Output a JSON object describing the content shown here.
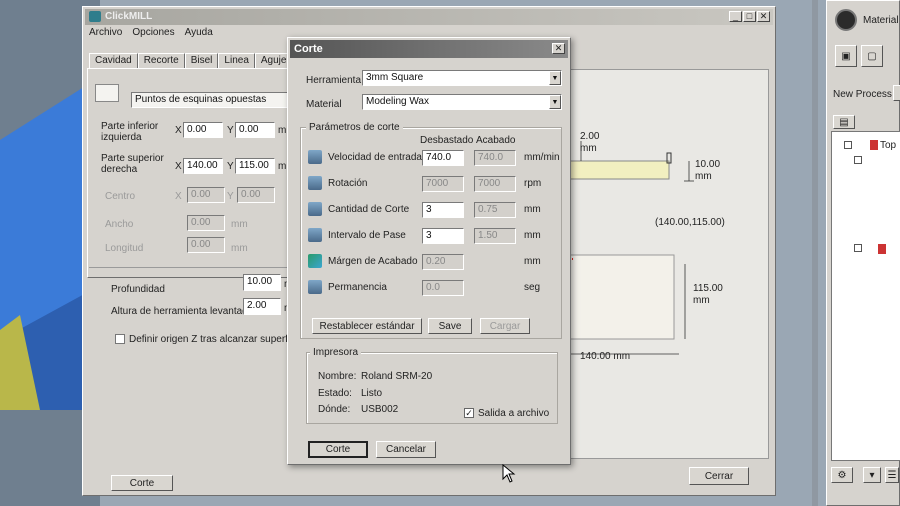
{
  "background": {
    "desktop": "#9aa7b4",
    "cad_blue": "#3b7bd8"
  },
  "main_window": {
    "title": "ClickMILL",
    "menu": [
      "Archivo",
      "Opciones",
      "Ayuda"
    ],
    "tabs": [
      "Cavidad",
      "Recorte",
      "Bisel",
      "Linea",
      "Agujero"
    ],
    "method_value": "Puntos de esquinas opuestas",
    "lower_left_label": "Parte inferior izquierda",
    "upper_right_label": "Parte superior derecha",
    "ll_x": "0.00",
    "ll_y": "0.00",
    "ur_x": "140.00",
    "ur_y": "115.00",
    "unit": "mm",
    "center_label": "Centro",
    "width_label": "Ancho",
    "length_label": "Longitud",
    "center_x": "0.00",
    "center_y": "0.00",
    "width_val": "0.00",
    "length_val": "0.00",
    "depth_label": "Profundidad",
    "depth_val": "10.00",
    "lift_label": "Altura de herramienta levantada",
    "lift_val": "2.00",
    "define_origin_label": "Definir origen Z tras alcanzar superficie",
    "cut_button": "Corte",
    "close_button": "Cerrar"
  },
  "drawing": {
    "dim_top": "2.00",
    "dim_top_unit": "mm",
    "dim_right_top": "10.00",
    "dim_right_top_unit": "mm",
    "corner_coord": "(140.00,115.00)",
    "dim_height": "115.00",
    "dim_height_unit": "mm",
    "dim_width": "140.00 mm"
  },
  "right_panel": {
    "material_label": "Material",
    "process_label": "New Process",
    "tree_top": "Top"
  },
  "dialog": {
    "title": "Corte",
    "tool_label": "Herramienta",
    "tool_value": "3mm Square",
    "material_label": "Material",
    "material_value": "Modeling Wax",
    "params_group": "Parámetros de corte",
    "col_rough": "Desbastado",
    "col_finish": "Acabado",
    "rows": [
      {
        "label": "Velocidad de entrada",
        "rough": "740.0",
        "finish": "740.0",
        "unit": "mm/min",
        "rough_enabled": true,
        "finish_enabled": false
      },
      {
        "label": "Rotación",
        "rough": "7000",
        "finish": "7000",
        "unit": "rpm",
        "rough_enabled": false,
        "finish_enabled": false
      },
      {
        "label": "Cantidad de Corte",
        "rough": "3",
        "finish": "0.75",
        "unit": "mm",
        "rough_enabled": true,
        "finish_enabled": false
      },
      {
        "label": "Intervalo de Pase",
        "rough": "3",
        "finish": "1.50",
        "unit": "mm",
        "rough_enabled": true,
        "finish_enabled": false
      },
      {
        "label": "Márgen de Acabado",
        "rough": "0.20",
        "finish": "",
        "unit": "mm",
        "rough_enabled": false,
        "finish_enabled": false
      },
      {
        "label": "Permanencia",
        "rough": "0.0",
        "finish": "",
        "unit": "seg",
        "rough_enabled": false,
        "finish_enabled": false
      }
    ],
    "reset_button": "Restablecer estándar",
    "save_button": "Save",
    "load_button": "Cargar",
    "printer_group": "Impresora",
    "name_label": "Nombre:",
    "name_value": "Roland SRM-20",
    "state_label": "Estado:",
    "state_value": "Listo",
    "where_label": "Dónde:",
    "where_value": "USB002",
    "output_file_label": "Salida a archivo",
    "output_file_checked": true,
    "ok_button": "Corte",
    "cancel_button": "Cancelar"
  }
}
